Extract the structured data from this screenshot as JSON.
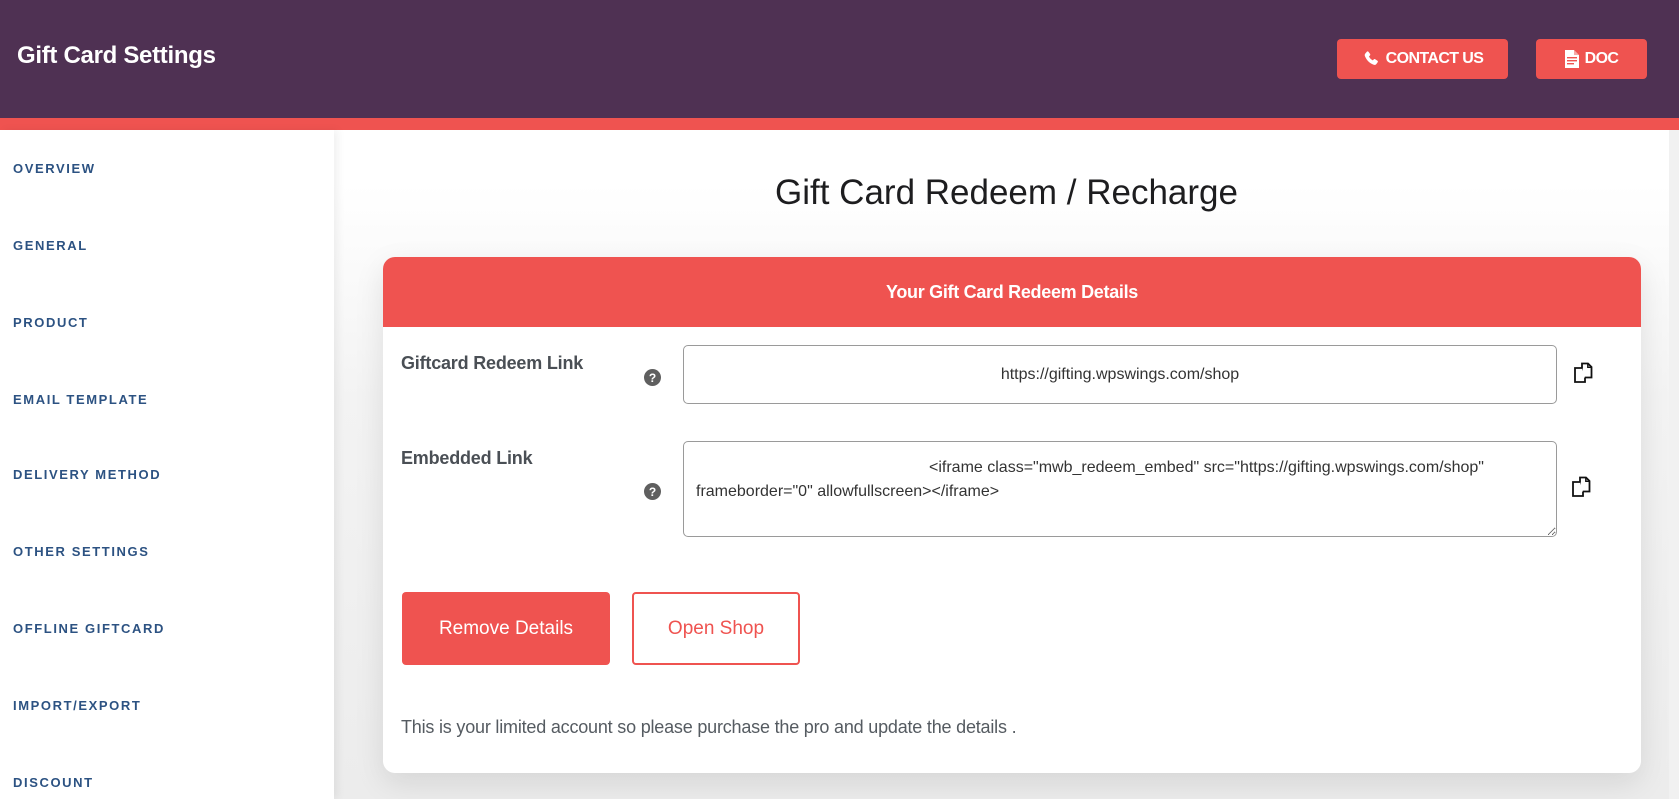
{
  "header": {
    "title": "Gift Card Settings",
    "contact_label": "CONTACT US",
    "contact_icon": "phone-icon",
    "doc_label": "DOC",
    "doc_icon": "document-icon"
  },
  "sidebar": {
    "items": [
      {
        "label": "OVERVIEW"
      },
      {
        "label": "GENERAL"
      },
      {
        "label": "PRODUCT"
      },
      {
        "label": "EMAIL TEMPLATE"
      },
      {
        "label": "DELIVERY METHOD"
      },
      {
        "label": "OTHER SETTINGS"
      },
      {
        "label": "OFFLINE GIFTCARD"
      },
      {
        "label": "IMPORT/EXPORT"
      },
      {
        "label": "DISCOUNT"
      }
    ]
  },
  "main": {
    "page_title": "Gift Card Redeem / Recharge",
    "card": {
      "header": "Your Gift Card Redeem Details",
      "fields": [
        {
          "label": "Giftcard Redeem Link",
          "help_icon": "question-circle-icon",
          "value": "https://gifting.wpswings.com/shop",
          "copy_icon": "copy-icon"
        },
        {
          "label": "Embedded Link",
          "help_icon": "question-circle-icon",
          "value": "<iframe class=\"mwb_redeem_embed\" src=\"https://gifting.wpswings.com/shop\" frameborder=\"0\" allowfullscreen></iframe>",
          "copy_icon": "copy-icon"
        }
      ],
      "remove_button": "Remove Details",
      "open_shop_button": "Open Shop",
      "notice": "This is your limited account so please purchase the pro and update the details ."
    }
  },
  "colors": {
    "header_bg": "#4f3153",
    "accent": "#ef5350",
    "nav_text": "#2c5282"
  }
}
